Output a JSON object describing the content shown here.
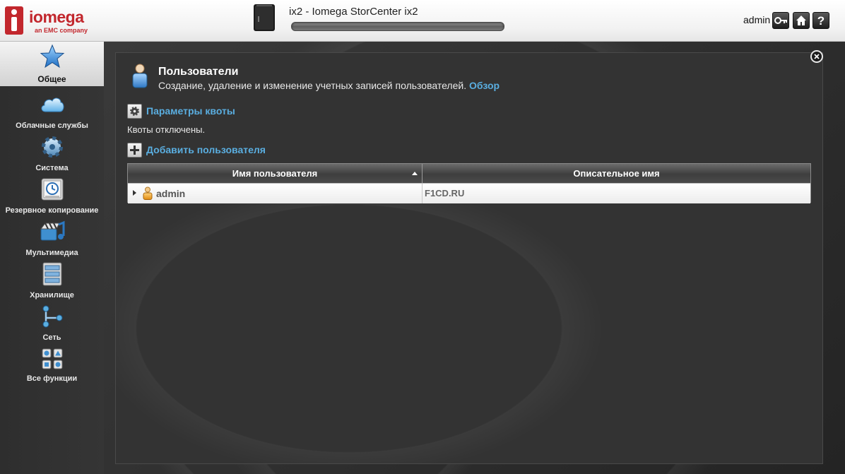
{
  "header": {
    "brand": "iomega",
    "brand_sub": "an EMC company",
    "device_title": "ix2 - Iomega StorCenter ix2",
    "user": "admin",
    "progress_fraction": 1.0
  },
  "sidebar": {
    "items": [
      {
        "label": "Общее",
        "icon": "star-icon",
        "active": true
      },
      {
        "label": "Облачные службы",
        "icon": "cloud-icon"
      },
      {
        "label": "Система",
        "icon": "gear-icon"
      },
      {
        "label": "Резервное копирование",
        "icon": "backup-clock-icon"
      },
      {
        "label": "Мультимедиа",
        "icon": "multimedia-icon"
      },
      {
        "label": "Хранилище",
        "icon": "storage-server-icon"
      },
      {
        "label": "Сеть",
        "icon": "network-icon"
      },
      {
        "label": "Все функции",
        "icon": "all-features-grid-icon"
      }
    ]
  },
  "page": {
    "title": "Пользователи",
    "description": "Создание, удаление и изменение учетных записей пользователей.",
    "overview_link": "Обзор",
    "quota_settings": "Параметры квоты",
    "quota_status": "Квоты отключены.",
    "add_user": "Добавить пользователя"
  },
  "table": {
    "columns": [
      "Имя пользователя",
      "Описательное имя"
    ],
    "rows": [
      {
        "username": "admin",
        "descriptive_name": "F1CD.RU"
      }
    ]
  },
  "colors": {
    "brand_red": "#c2272d",
    "link_blue": "#5aaee0",
    "panel_bg": "#333333"
  }
}
